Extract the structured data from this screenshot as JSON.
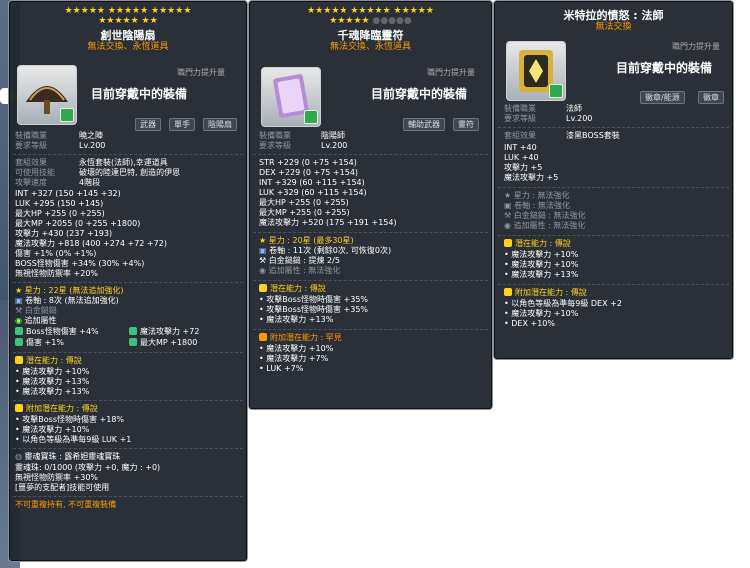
{
  "panel1": {
    "stars": [
      "★★★★★",
      "★★★★★",
      "★★★★★",
      "★★★★★",
      "★★"
    ],
    "title": "創世陰陽扇",
    "subtitle": "無法交換、永恆道具",
    "attack_label": "職門力提升量",
    "wearing": "目前穿戴中的裝備",
    "tags": [
      "武器",
      "單手",
      "陰陽扇"
    ],
    "job": "裝備職業",
    "job_val": "曉之陣",
    "req": "要求等級",
    "req_val": "Lv.200",
    "set": "套組效果",
    "set_val": "永恆套裝(法師),幸運道具",
    "skill": "可使用技能",
    "skill_val": "破壞的陸達巴特, 創造的伊恩",
    "speed": "攻擊速度",
    "speed_val": "4階段",
    "int": "INT +327 (150 +145 +32)",
    "luk": "LUK +295 (150 +145)",
    "hp": "最大HP +255 (0 +255)",
    "mp": "最大MP +2055 (0 +255 +1800)",
    "atk": "攻擊力 +430 (237 +193)",
    "matk": "魔法攻擊力 +818 (400 +274 +72 +72)",
    "dmg": "傷害 +1% (0% +1%)",
    "boss": "BOSS怪物傷害 +34% (30% +4%)",
    "ignore": "無視怪物防禦率 +20%",
    "starforce": "星力 : 22星 (無法追加強化)",
    "scroll": "卷軸 : 8次 (無法追加強化)",
    "gold": "白金鎚鎚",
    "extra": "追加屬性",
    "extra_boss": "Boss怪物傷害 +4%",
    "extra_matk": "魔法攻擊力 +72",
    "extra_dmg": "傷害 +1%",
    "extra_mp": "最大MP +1800",
    "pot_h": "潛在能力",
    "pot_grade": "傳說",
    "pot1": "魔法攻擊力 +10%",
    "pot2": "魔法攻擊力 +13%",
    "pot3": "魔法攻擊力 +13%",
    "add_h": "附加潛在能力",
    "add_grade": "傳說",
    "add1": "攻擊Boss怪物時傷害 +18%",
    "add2": "魔法攻擊力 +10%",
    "add3": "以角色等級為準每9級 LUK +1",
    "soul_h": "靈魂寶珠",
    "soul_h_val": "露希妲靈魂寶珠",
    "soul1": "靈魂珠: 0/1000 (攻擊力 +0, 魔力 : +0)",
    "soul2": "無視怪物防禦率 +30%",
    "soul3": "[噩夢的支配者]技能可使用",
    "foot": "不可重複持有, 不可重複裝備"
  },
  "panel2": {
    "stars": [
      "★★★★★",
      "★★★★★",
      "★★★★★",
      "★★★★★"
    ],
    "stars_off": [
      "●●●●●"
    ],
    "title": "千魂降臨靈符",
    "subtitle": "無法交換、永恆道具",
    "attack_label": "職門力提升量",
    "wearing": "目前穿戴中的裝備",
    "tags": [
      "輔助武器",
      "靈符"
    ],
    "job": "裝備職業",
    "job_val": "陰陽師",
    "req": "要求等級",
    "req_val": "Lv.200",
    "str": "STR +229 (0 +75 +154)",
    "dex": "DEX +229 (0 +75 +154)",
    "int": "INT +329 (60 +115 +154)",
    "luk": "LUK +329 (60 +115 +154)",
    "hp": "最大HP +255 (0 +255)",
    "mp": "最大MP +255 (0 +255)",
    "matk": "魔法攻擊力 +520 (175 +191 +154)",
    "starforce": "星力 : 20星 (最多30星)",
    "scroll": "卷軸 : 11次 (剩餘0次, 可恢復0次)",
    "gold": "白金鎚鎚 : 提煉 2/5",
    "extra": "追加屬性 : 無法強化",
    "pot_h": "潛在能力",
    "pot_grade": "傳說",
    "pot1": "攻擊Boss怪物時傷害 +35%",
    "pot2": "攻擊Boss怪物時傷害 +35%",
    "pot3": "魔法攻擊力 +13%",
    "add_h": "附加潛在能力",
    "add_grade": "罕見",
    "add1": "魔法攻擊力 +10%",
    "add2": "魔法攻擊力 +7%",
    "add3": "LUK +7%"
  },
  "panel3": {
    "title": "米特拉的憤怒 : 法師",
    "subtitle": "無法交換",
    "attack_label": "職門力提升量",
    "wearing": "目前穿戴中的裝備",
    "tags": [
      "徽章/能源",
      "徽章"
    ],
    "job": "裝備職業",
    "job_val": "法師",
    "req": "要求等級",
    "req_val": "Lv.200",
    "set": "套組效果",
    "set_val": "漆黑BOSS套裝",
    "int": "INT +40",
    "luk": "LUK +40",
    "atk": "攻擊力 +5",
    "matk": "魔法攻擊力 +5",
    "starforce": "星力 : 無法強化",
    "scroll": "卷軸 : 無法強化",
    "gold": "白金鎚鎚 : 無法強化",
    "extra": "追加屬性 : 無法強化",
    "pot_h": "潛在能力",
    "pot_grade": "傳說",
    "pot1": "魔法攻擊力 +10%",
    "pot2": "魔法攻擊力 +10%",
    "pot3": "魔法攻擊力 +13%",
    "add_h": "附加潛在能力",
    "add_grade": "傳說",
    "add1": "以角色等級為準每9級 DEX +2",
    "add2": "魔法攻擊力 +10%",
    "add3": "DEX +10%"
  }
}
